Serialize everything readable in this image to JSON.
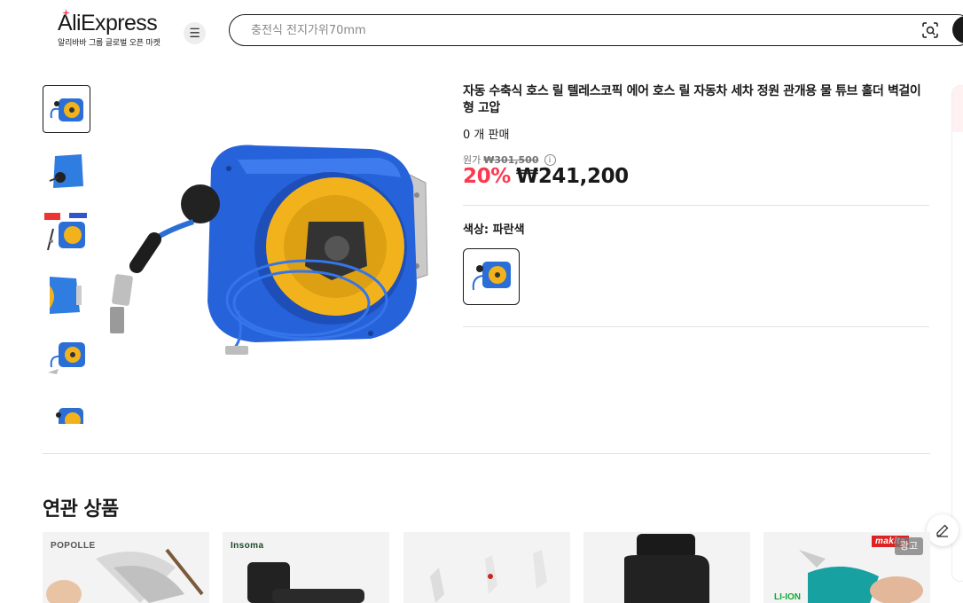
{
  "header": {
    "logo_text": "AliExpress",
    "logo_sub": "알리바바 그룹 글로벌 오픈 마켓",
    "search_placeholder": "충전식 전지가위70mm",
    "menu_icon": "hamburger-icon",
    "camera_icon": "image-search-icon",
    "accent_color": "#fd384f"
  },
  "product": {
    "title": "자동 수축식 호스 릴 텔레스코픽 에어 호스 릴 자동차 세차 정원 관개용 물 튜브 홀더 벽걸이형 고압",
    "sold": "0 개 판매",
    "original_label": "원가",
    "original_price": "₩301,500",
    "discount": "20%",
    "price": "₩241,200",
    "color_label": "색상: 파란색",
    "thumbnail_count": 6
  },
  "related": {
    "title": "연관 상품",
    "cards": [
      {
        "brand": "POPOLLE"
      },
      {
        "brand": "Insoma"
      },
      {
        "brand": ""
      },
      {
        "brand": ""
      },
      {
        "brand": "makita",
        "ad": "광고"
      }
    ]
  }
}
